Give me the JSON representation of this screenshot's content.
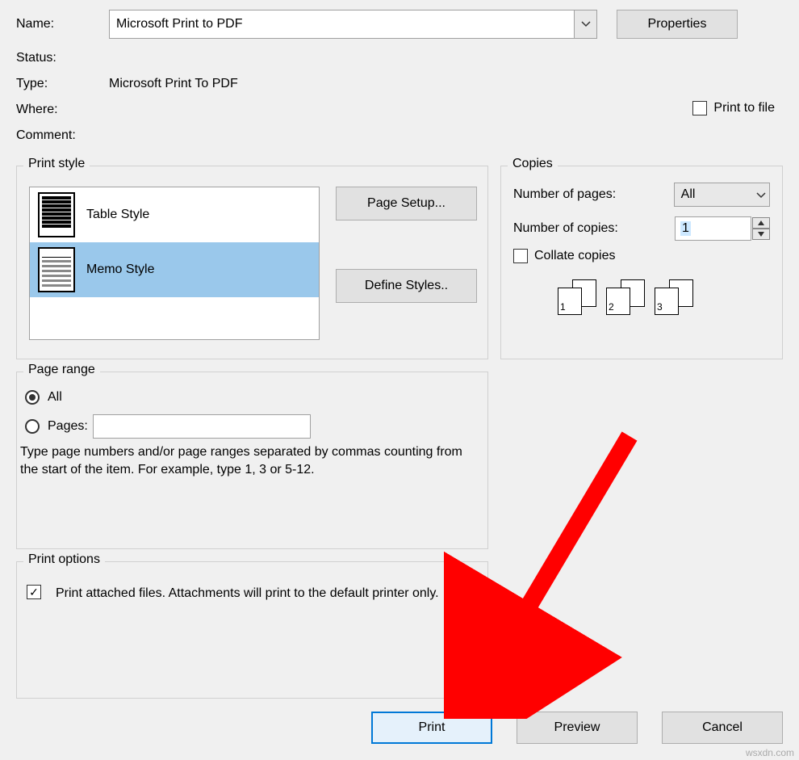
{
  "printer": {
    "name_label": "Name:",
    "name_value": "Microsoft Print to PDF",
    "properties_btn": "Properties",
    "status_label": "Status:",
    "status_value": "",
    "type_label": "Type:",
    "type_value": "Microsoft Print To PDF",
    "where_label": "Where:",
    "where_value": "",
    "comment_label": "Comment:",
    "comment_value": "",
    "print_to_file_label": "Print to file",
    "print_to_file_checked": false
  },
  "print_style": {
    "legend": "Print style",
    "items": [
      {
        "label": "Table Style",
        "selected": false,
        "icon": "table"
      },
      {
        "label": "Memo Style",
        "selected": true,
        "icon": "memo"
      }
    ],
    "page_setup_btn": "Page Setup...",
    "define_styles_btn": "Define Styles.."
  },
  "copies": {
    "legend": "Copies",
    "num_pages_label": "Number of pages:",
    "num_pages_value": "All",
    "num_copies_label": "Number of copies:",
    "num_copies_value": "1",
    "collate_label": "Collate copies",
    "collate_checked": false,
    "stack_labels": [
      "1",
      "2",
      "3"
    ]
  },
  "page_range": {
    "legend": "Page range",
    "all_label": "All",
    "all_selected": true,
    "pages_label": "Pages:",
    "pages_selected": false,
    "pages_value": "",
    "hint": "Type page numbers and/or page ranges separated by commas counting from the start of the item.  For example, type 1, 3 or 5-12."
  },
  "print_options": {
    "legend": "Print options",
    "attach_checked": true,
    "attach_label": "Print attached files.  Attachments will print to the default printer only."
  },
  "buttons": {
    "print": "Print",
    "preview": "Preview",
    "cancel": "Cancel"
  },
  "watermark": "wsxdn.com"
}
